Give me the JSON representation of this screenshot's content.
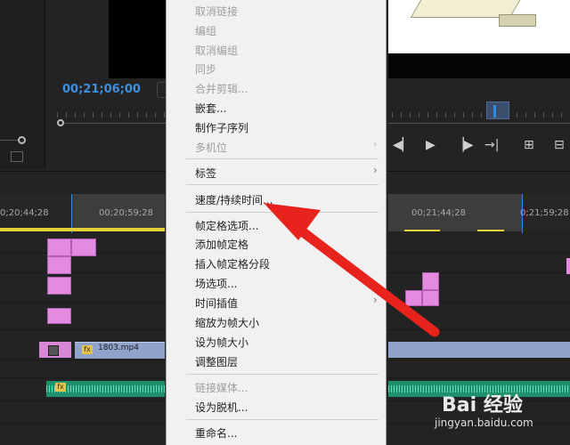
{
  "monitor": {
    "timecode": "00;21;06;00"
  },
  "ruler": {
    "ticks": [
      "0;20;44;28",
      "00;20;59;28",
      "00;21;44;28",
      "0;21;59;28"
    ]
  },
  "clip": {
    "video_name": "1803.mp4",
    "fx_label": "fx"
  },
  "context_menu": {
    "items": [
      {
        "label": "取消链接",
        "disabled": true
      },
      {
        "label": "编组",
        "disabled": true
      },
      {
        "label": "取消编组",
        "disabled": true
      },
      {
        "label": "同步",
        "disabled": true
      },
      {
        "label": "合并剪辑...",
        "disabled": true
      },
      {
        "label": "嵌套...",
        "disabled": false
      },
      {
        "label": "制作子序列",
        "disabled": false
      },
      {
        "label": "多机位",
        "disabled": true
      },
      {
        "label": "标签",
        "disabled": false
      },
      {
        "label": "速度/持续时间...",
        "disabled": false
      },
      {
        "label": "帧定格选项...",
        "disabled": false
      },
      {
        "label": "添加帧定格",
        "disabled": false
      },
      {
        "label": "插入帧定格分段",
        "disabled": false
      },
      {
        "label": "场选项...",
        "disabled": false
      },
      {
        "label": "时间插值",
        "disabled": false
      },
      {
        "label": "缩放为帧大小",
        "disabled": false
      },
      {
        "label": "设为帧大小",
        "disabled": false
      },
      {
        "label": "调整图层",
        "disabled": false
      },
      {
        "label": "链接媒体...",
        "disabled": true
      },
      {
        "label": "设为脱机...",
        "disabled": false
      },
      {
        "label": "重命名...",
        "disabled": false
      }
    ],
    "submenu_glyph": "›"
  },
  "annotation": {
    "arrow_color": "#e8231e"
  },
  "watermark": {
    "logo": "Bai 经验",
    "url": "jingyan.baidu.com"
  }
}
